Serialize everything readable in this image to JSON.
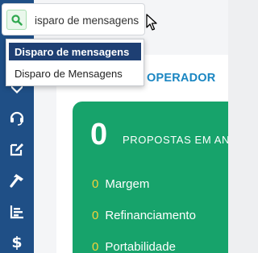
{
  "search": {
    "value": "isparo de mensagens",
    "suggestions": [
      {
        "label": "Disparo de mensagens",
        "highlighted": true
      },
      {
        "label": "Disparo de Mensagens",
        "highlighted": false
      }
    ]
  },
  "sidebar": {
    "icons": [
      "headset-icon",
      "edit-icon",
      "hammer-icon",
      "chart-icon",
      "dollar-icon"
    ]
  },
  "main": {
    "section_title": "OPERADOR"
  },
  "card": {
    "count": "0",
    "title": "PROPOSTAS EM AN",
    "rows": [
      {
        "value": "0",
        "label": "Margem"
      },
      {
        "value": "0",
        "label": "Refinanciamento"
      },
      {
        "value": "0",
        "label": "Portabilidade"
      }
    ]
  },
  "colors": {
    "sidebar": "#1f4f86",
    "card": "#17a36b",
    "accent_title": "#1a86c2",
    "row_value": "#f5d23a",
    "dropdown_highlight": "#1e3f73"
  }
}
